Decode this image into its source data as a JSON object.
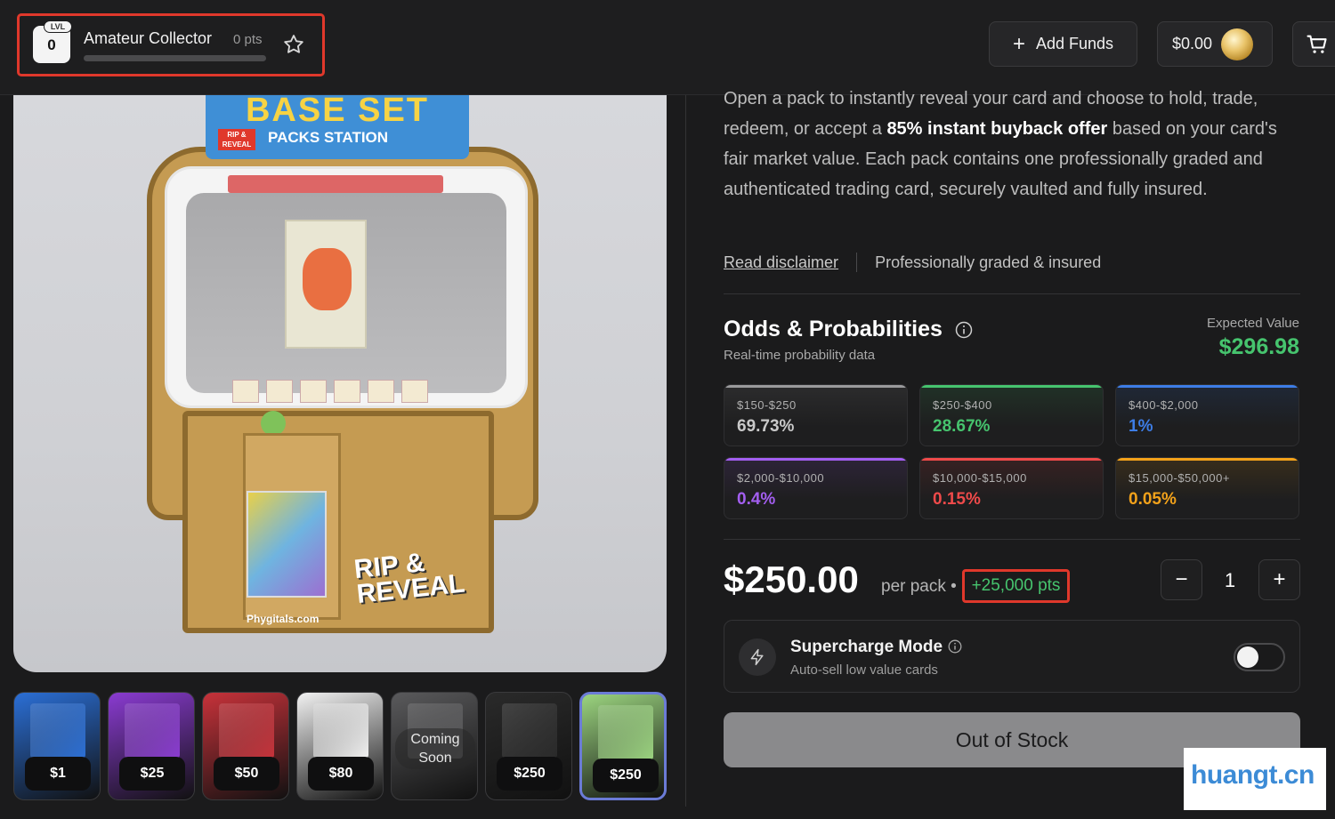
{
  "header": {
    "level_tag": "LVL",
    "level_number": "0",
    "rank_name": "Amateur Collector",
    "rank_points": "0 pts",
    "rank_progress": 0,
    "add_funds_label": "Add Funds",
    "balance": "$0.00",
    "icons": [
      "star-icon",
      "plus-icon",
      "coin-icon",
      "cart-icon"
    ]
  },
  "hero": {
    "sign_title": "BASE SET",
    "sign_subtitle": "PACKS STATION",
    "sign_badge": "RIP & REVEAL",
    "rip_text": "RIP & REVEAL",
    "site_text": "Phygitals.com"
  },
  "thumbnails": [
    {
      "price": "$1",
      "color": "#2b6fd6"
    },
    {
      "price": "$25",
      "color": "#8a3bd1"
    },
    {
      "price": "$50",
      "color": "#c7323a"
    },
    {
      "price": "$80",
      "color": "#f2f2f2"
    },
    {
      "coming_soon": "Coming Soon",
      "color": "#5a5a5c"
    },
    {
      "price": "$250",
      "color": "#2a2a2a"
    },
    {
      "price": "$250",
      "color": "#9bd47f",
      "selected": true
    }
  ],
  "description": {
    "part1": "Open a pack to instantly reveal your card and choose to hold, trade, redeem, or accept a ",
    "bold": "85% instant buyback offer",
    "part2": " based on your card's fair market value. Each pack contains one professionally graded and authenticated trading card, securely vaulted and fully insured."
  },
  "disclaimer": {
    "link": "Read disclaimer",
    "note": "Professionally graded & insured"
  },
  "odds": {
    "title": "Odds & Probabilities",
    "subtitle": "Real-time probability data",
    "ev_label": "Expected Value",
    "ev_value": "$296.98",
    "tiers": [
      {
        "range": "$150-$250",
        "pct": "69.73%",
        "color": "#9a9a9c"
      },
      {
        "range": "$250-$400",
        "pct": "28.67%",
        "color": "#46c46e"
      },
      {
        "range": "$400-$2,000",
        "pct": "1%",
        "color": "#3d7de6"
      },
      {
        "range": "$2,000-$10,000",
        "pct": "0.4%",
        "color": "#a35ef0"
      },
      {
        "range": "$10,000-$15,000",
        "pct": "0.15%",
        "color": "#ef4a4a"
      },
      {
        "range": "$15,000-$50,000+",
        "pct": "0.05%",
        "color": "#f3a21a"
      }
    ]
  },
  "purchase": {
    "price": "$250.00",
    "per_pack": "per pack •",
    "points_bonus": "+25,000 pts",
    "quantity": "1",
    "minus": "−",
    "plus": "+"
  },
  "supercharge": {
    "title": "Supercharge Mode",
    "subtitle": "Auto-sell low value cards",
    "enabled": false
  },
  "cta": {
    "label": "Out of Stock"
  },
  "watermark": "huangt.cn"
}
